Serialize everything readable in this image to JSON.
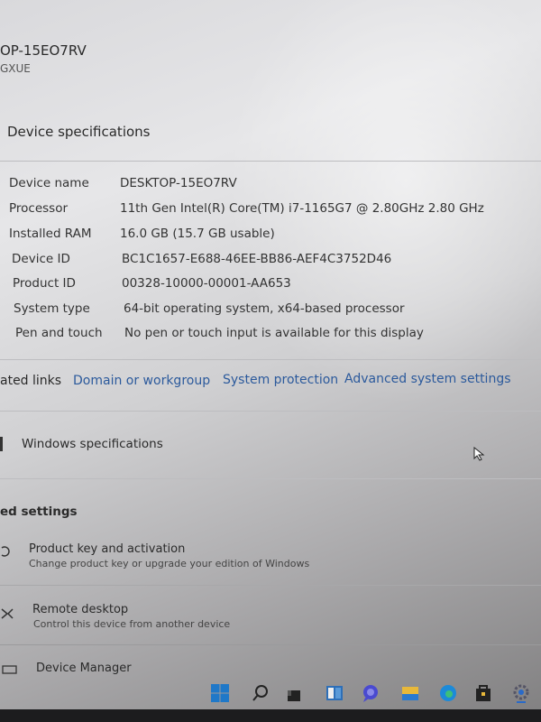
{
  "header": {
    "device_name": "OP-15EO7RV",
    "device_sub": "GXUE"
  },
  "device_specs": {
    "title": "Device specifications",
    "rows": [
      {
        "label": "Device name",
        "value": "DESKTOP-15EO7RV"
      },
      {
        "label": "Processor",
        "value": "11th Gen Intel(R) Core(TM) i7-1165G7 @ 2.80GHz   2.80 GHz"
      },
      {
        "label": "Installed RAM",
        "value": "16.0 GB (15.7 GB usable)"
      },
      {
        "label": "Device ID",
        "value": "BC1C1657-E688-46EE-BB86-AEF4C3752D46"
      },
      {
        "label": "Product ID",
        "value": "00328-10000-00001-AA653"
      },
      {
        "label": "System type",
        "value": "64-bit operating system, x64-based processor"
      },
      {
        "label": "Pen and touch",
        "value": "No pen or touch input is available for this display"
      }
    ]
  },
  "related_links": {
    "label": "ated links",
    "links": [
      "Domain or workgroup",
      "System protection",
      "Advanced system settings"
    ]
  },
  "windows_specs": {
    "title": "Windows specifications"
  },
  "related_settings": {
    "title": "ed settings",
    "items": [
      {
        "title": "Product key and activation",
        "subtitle": "Change product key or upgrade your edition of Windows",
        "icon": "key-icon"
      },
      {
        "title": "Remote desktop",
        "subtitle": "Control this device from another device",
        "icon": "remote-desktop-icon"
      },
      {
        "title": "Device Manager",
        "icon": "printer-icon"
      }
    ]
  },
  "taskbar": {
    "icons": [
      "start-icon",
      "search-icon",
      "task-view-icon",
      "widgets-icon",
      "chat-icon",
      "file-explorer-icon",
      "edge-icon",
      "store-icon",
      "settings-icon"
    ]
  },
  "colors": {
    "link": "#2c5a9c",
    "accent": "#1f78c8"
  }
}
